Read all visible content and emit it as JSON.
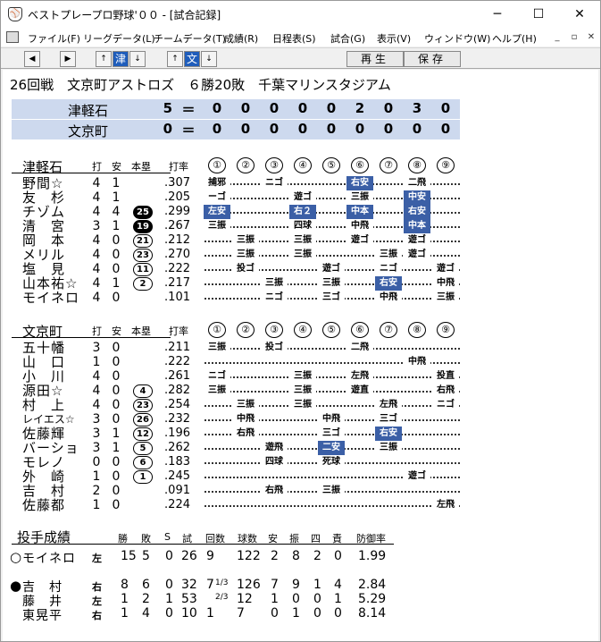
{
  "window": {
    "title": "ベストプレープロ野球'００ - [試合記録]",
    "icon": "baseball-icon",
    "min": "─",
    "max": "☐",
    "close": "✕"
  },
  "menu": [
    "ファイル(F)",
    "リーグデータ(L)",
    "チームデータ(T)",
    "成績(R)",
    "日程表(S)",
    "試合(G)",
    "表示(V)",
    "ウィンドウ(W)",
    "ヘルプ(H)"
  ],
  "mdi": {
    "min": "_",
    "restore": "▫",
    "close": "✕"
  },
  "toolbar": {
    "left": "◀",
    "right": "▶",
    "up": "↑",
    "team1": "津",
    "down": "↓",
    "team2": "文",
    "play": "再生",
    "save": "保存"
  },
  "game": {
    "title": "26回戦　文京町アストロズ　６勝20敗　千葉マリンスタジアム"
  },
  "scoreboard": [
    {
      "team": "津軽石",
      "runs": "5",
      "eq": "＝",
      "innings": [
        "0",
        "0",
        "0",
        "0",
        "0",
        "2",
        "0",
        "3",
        "0"
      ]
    },
    {
      "team": "文京町",
      "runs": "0",
      "eq": "＝",
      "innings": [
        "0",
        "0",
        "0",
        "0",
        "0",
        "0",
        "0",
        "0",
        "0"
      ]
    }
  ],
  "headers": {
    "ab": "打",
    "h": "安",
    "hr": "本塁",
    "avg": "打率",
    "innings": [
      "①",
      "②",
      "③",
      "④",
      "⑤",
      "⑥",
      "⑦",
      "⑧",
      "⑨"
    ]
  },
  "away": {
    "team": "津軽石",
    "players": [
      {
        "name": "野間☆",
        "ab": "4",
        "h": "1",
        "hr": "",
        "avg": ".307",
        "res": [
          [
            "1",
            "捕邪",
            false
          ],
          [
            "3",
            "ニゴ",
            false
          ],
          [
            "6",
            "右安",
            true
          ],
          [
            "8",
            "二飛",
            false
          ]
        ]
      },
      {
        "name": "友　杉",
        "ab": "4",
        "h": "1",
        "hr": "",
        "avg": ".205",
        "res": [
          [
            "1",
            "ーゴ",
            false
          ],
          [
            "4",
            "遊ゴ",
            false
          ],
          [
            "6",
            "三振",
            false
          ],
          [
            "8",
            "中安",
            true
          ]
        ]
      },
      {
        "name": "チゾム",
        "ab": "4",
        "h": "4",
        "hr": "25",
        "hrDark": true,
        "avg": ".299",
        "res": [
          [
            "1",
            "左安",
            true
          ],
          [
            "4",
            "右２",
            true
          ],
          [
            "6",
            "中本",
            true
          ],
          [
            "8",
            "右安",
            true
          ]
        ]
      },
      {
        "name": "清　宮",
        "ab": "3",
        "h": "1",
        "hr": "19",
        "hrDark": true,
        "avg": ".267",
        "res": [
          [
            "1",
            "三振",
            false
          ],
          [
            "4",
            "四球",
            false
          ],
          [
            "6",
            "中飛",
            false
          ],
          [
            "8",
            "中本",
            true
          ]
        ]
      },
      {
        "name": "岡　本",
        "ab": "4",
        "h": "0",
        "hr": "21",
        "hrDark": false,
        "avg": ".212",
        "res": [
          [
            "2",
            "三振",
            false
          ],
          [
            "4",
            "三振",
            false
          ],
          [
            "6",
            "遊ゴ",
            false
          ],
          [
            "8",
            "遊ゴ",
            false
          ]
        ]
      },
      {
        "name": "メリル",
        "ab": "4",
        "h": "0",
        "hr": "23",
        "hrDark": false,
        "avg": ".270",
        "res": [
          [
            "2",
            "三振",
            false
          ],
          [
            "4",
            "三振",
            false
          ],
          [
            "7",
            "三振",
            false
          ],
          [
            "8",
            "遊ゴ",
            false
          ]
        ]
      },
      {
        "name": "塩　見",
        "ab": "4",
        "h": "0",
        "hr": "11",
        "hrDark": false,
        "avg": ".222",
        "res": [
          [
            "2",
            "投ゴ",
            false
          ],
          [
            "5",
            "遊ゴ",
            false
          ],
          [
            "7",
            "ニゴ",
            false
          ],
          [
            "9",
            "遊ゴ",
            false
          ]
        ]
      },
      {
        "name": "山本祐☆",
        "ab": "4",
        "h": "1",
        "hr": "2",
        "hrDark": false,
        "avg": ".217",
        "res": [
          [
            "3",
            "三振",
            false
          ],
          [
            "5",
            "三振",
            false
          ],
          [
            "7",
            "右安",
            true
          ],
          [
            "9",
            "中飛",
            false
          ]
        ]
      },
      {
        "name": "モイネロ",
        "ab": "4",
        "h": "0",
        "hr": "",
        "avg": ".101",
        "res": [
          [
            "3",
            "ニゴ",
            false
          ],
          [
            "5",
            "三ゴ",
            false
          ],
          [
            "7",
            "中飛",
            false
          ],
          [
            "9",
            "三振",
            false
          ]
        ]
      }
    ]
  },
  "home": {
    "team": "文京町",
    "players": [
      {
        "name": "五十幡",
        "ab": "3",
        "h": "0",
        "hr": "",
        "avg": ".211",
        "res": [
          [
            "1",
            "三振",
            false
          ],
          [
            "3",
            "投ゴ",
            false
          ],
          [
            "6",
            "二飛",
            false
          ]
        ]
      },
      {
        "name": "山　口",
        "ab": "1",
        "h": "0",
        "hr": "",
        "avg": ".222",
        "res": [
          [
            "8",
            "中飛",
            false
          ]
        ]
      },
      {
        "name": "小　川",
        "ab": "4",
        "h": "0",
        "hr": "",
        "avg": ".261",
        "res": [
          [
            "1",
            "ニゴ",
            false
          ],
          [
            "4",
            "三振",
            false
          ],
          [
            "6",
            "左飛",
            false
          ],
          [
            "9",
            "投直",
            false
          ]
        ]
      },
      {
        "name": "源田☆",
        "ab": "4",
        "h": "0",
        "hr": "4",
        "hrDark": false,
        "avg": ".282",
        "res": [
          [
            "1",
            "三振",
            false
          ],
          [
            "4",
            "三振",
            false
          ],
          [
            "6",
            "遊直",
            false
          ],
          [
            "9",
            "右飛",
            false
          ]
        ]
      },
      {
        "name": "村　上",
        "ab": "4",
        "h": "0",
        "hr": "23",
        "hrDark": false,
        "avg": ".254",
        "res": [
          [
            "2",
            "三振",
            false
          ],
          [
            "4",
            "三振",
            false
          ],
          [
            "7",
            "左飛",
            false
          ],
          [
            "9",
            "ニゴ",
            false
          ]
        ]
      },
      {
        "name": "レイエス☆",
        "ab": "3",
        "h": "0",
        "hr": "26",
        "hrDark": false,
        "avg": ".232",
        "res": [
          [
            "2",
            "中飛",
            false
          ],
          [
            "5",
            "中飛",
            false
          ],
          [
            "7",
            "三ゴ",
            false
          ]
        ]
      },
      {
        "name": "佐藤輝",
        "ab": "3",
        "h": "1",
        "hr": "12",
        "hrDark": false,
        "avg": ".196",
        "res": [
          [
            "2",
            "右飛",
            false
          ],
          [
            "5",
            "三ゴ",
            false
          ],
          [
            "7",
            "右安",
            true
          ]
        ]
      },
      {
        "name": "バーショ",
        "ab": "3",
        "h": "1",
        "hr": "5",
        "hrDark": false,
        "avg": ".262",
        "res": [
          [
            "3",
            "遊飛",
            false
          ],
          [
            "5",
            "二安",
            true
          ],
          [
            "7",
            "三振",
            false
          ]
        ]
      },
      {
        "name": "モレノ",
        "ab": "0",
        "h": "0",
        "hr": "6",
        "hrDark": false,
        "avg": ".183",
        "res": [
          [
            "3",
            "四球",
            false
          ],
          [
            "5",
            "死球",
            false
          ]
        ]
      },
      {
        "name": "外　崎",
        "ab": "1",
        "h": "0",
        "hr": "1",
        "hrDark": false,
        "avg": ".245",
        "res": [
          [
            "8",
            "遊ゴ",
            false
          ]
        ]
      },
      {
        "name": "吉　村",
        "ab": "2",
        "h": "0",
        "hr": "",
        "avg": ".091",
        "res": [
          [
            "3",
            "右飛",
            false
          ],
          [
            "5",
            "三振",
            false
          ]
        ]
      },
      {
        "name": "佐藤都",
        "ab": "1",
        "h": "0",
        "hr": "",
        "avg": ".224",
        "res": [
          [
            "9",
            "左飛",
            false
          ]
        ]
      }
    ]
  },
  "pitching": {
    "title": "投手成績",
    "cols": [
      "勝",
      "敗",
      "S",
      "試",
      "回数",
      "球数",
      "安",
      "振",
      "四",
      "責",
      "防御率"
    ],
    "rows": [
      {
        "mark": "○",
        "name": "モイネロ",
        "hand": "左",
        "w": "15",
        "l": "5",
        "s": "0",
        "g": "26",
        "ip": "9",
        "ipf": "",
        "np": "122",
        "h": "2",
        "so": "8",
        "bb": "2",
        "er": "0",
        "era": "1.99"
      },
      {
        "mark": "●",
        "name": "吉　村",
        "hand": "右",
        "w": "8",
        "l": "6",
        "s": "0",
        "g": "32",
        "ip": "7",
        "ipf": "1/3",
        "np": "126",
        "h": "7",
        "so": "9",
        "bb": "1",
        "er": "4",
        "era": "2.84"
      },
      {
        "mark": "",
        "name": "藤　井",
        "hand": "左",
        "w": "1",
        "l": "2",
        "s": "1",
        "g": "53",
        "ip": "",
        "ipf": "2/3",
        "np": "12",
        "h": "1",
        "so": "0",
        "bb": "0",
        "er": "1",
        "era": "5.29"
      },
      {
        "mark": "",
        "name": "東晃平",
        "hand": "右",
        "w": "1",
        "l": "4",
        "s": "0",
        "g": "10",
        "ip": "1",
        "ipf": "",
        "np": "7",
        "h": "0",
        "so": "1",
        "bb": "0",
        "er": "0",
        "era": "8.14"
      }
    ]
  }
}
